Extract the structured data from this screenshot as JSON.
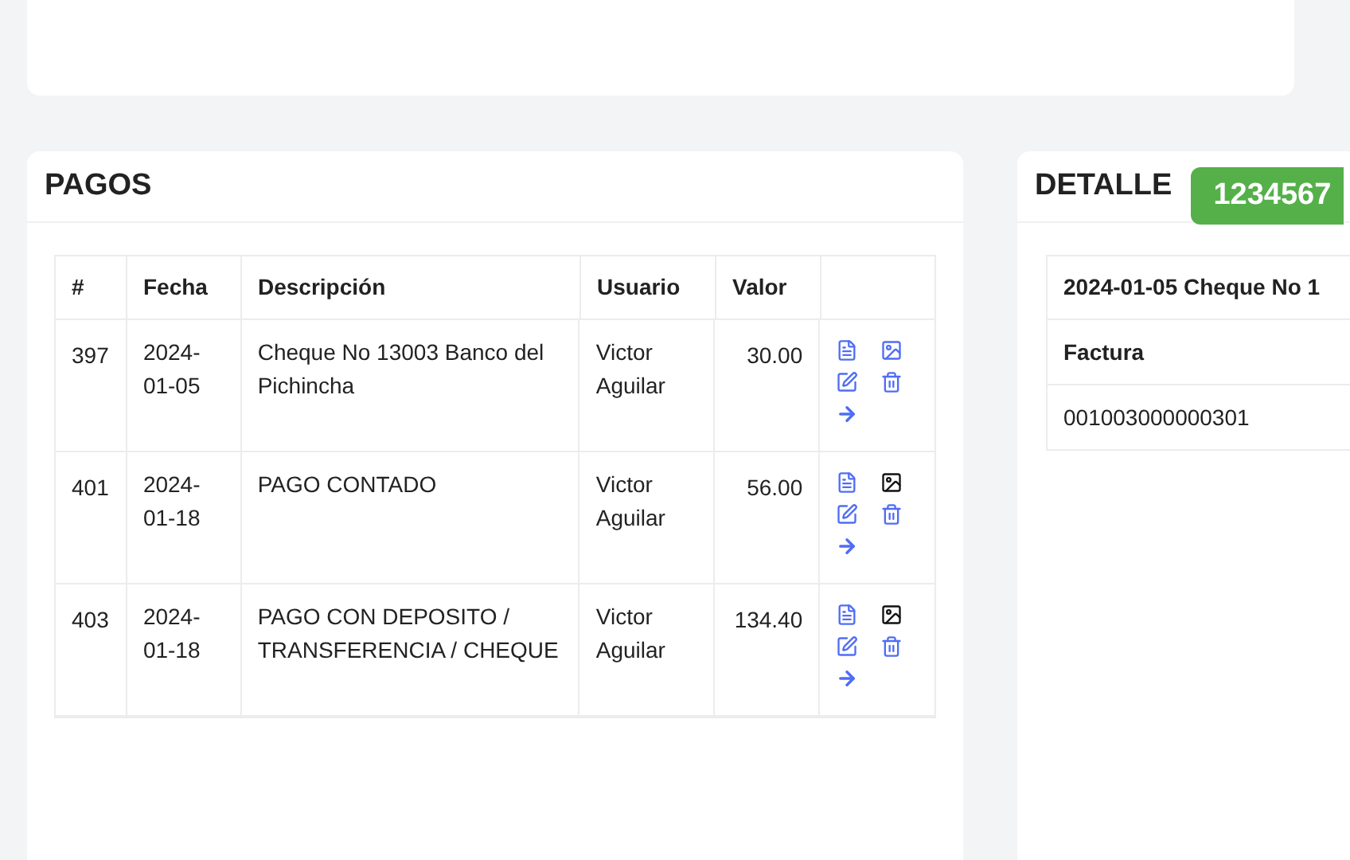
{
  "pagos": {
    "title": "PAGOS",
    "columns": [
      "#",
      "Fecha",
      "Descripción",
      "Usuario",
      "Valor"
    ],
    "rows": [
      {
        "id": "397",
        "fecha": "2024-\n01-05",
        "descripcion": "Cheque No 13003 Banco del Pichincha",
        "usuario": "Victor Aguilar",
        "valor": "30.00",
        "image_attached": true
      },
      {
        "id": "401",
        "fecha": "2024-\n01-18",
        "descripcion": "PAGO CONTADO",
        "usuario": "Victor Aguilar",
        "valor": "56.00",
        "image_attached": false
      },
      {
        "id": "403",
        "fecha": "2024-\n01-18",
        "descripcion": "PAGO CON DEPOSITO / TRANSFERENCIA / CHEQUE",
        "usuario": "Victor Aguilar",
        "valor": "134.40",
        "image_attached": false
      }
    ]
  },
  "detalle": {
    "title": "DETALLE",
    "badge": "1234567",
    "heading": "2024-01-05 Cheque No 1",
    "label": "Factura",
    "value": "001003000000301"
  }
}
